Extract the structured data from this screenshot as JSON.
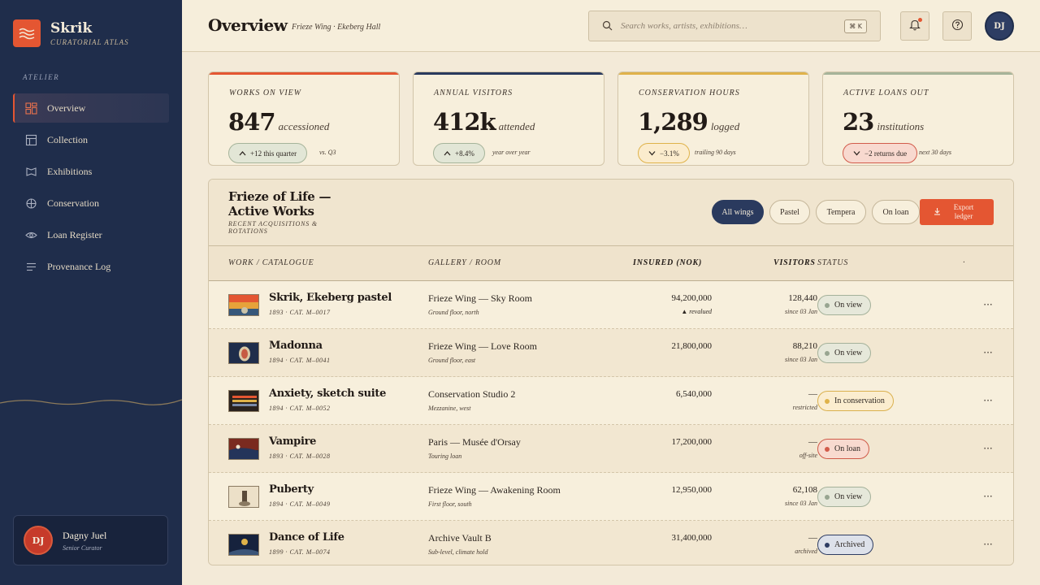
{
  "brand": {
    "name": "Skrik",
    "subtitle": "CURATORIAL ATLAS"
  },
  "sidebar": {
    "section_label": "ATELIER",
    "items": [
      {
        "label": "Overview",
        "icon": "dashboard-icon",
        "active": true
      },
      {
        "label": "Collection",
        "icon": "table-icon",
        "active": false
      },
      {
        "label": "Exhibitions",
        "icon": "flag-icon",
        "active": false
      },
      {
        "label": "Conservation",
        "icon": "crosshair-icon",
        "active": false
      },
      {
        "label": "Loan Register",
        "icon": "eye-icon",
        "active": false
      },
      {
        "label": "Provenance Log",
        "icon": "lines-icon",
        "active": false
      }
    ],
    "user": {
      "initials": "DJ",
      "name": "Dagny Juel",
      "role": "Senior Curator"
    }
  },
  "header": {
    "title": "Overview",
    "subtitle": "Frieze Wing · Ekeberg Hall",
    "search_placeholder": "Search works, artists, exhibitions…",
    "shortcut": "⌘ K",
    "avatar_initials": "DJ"
  },
  "stats": [
    {
      "label": "WORKS ON VIEW",
      "value": "847",
      "unit": "accessioned",
      "pill": "+12 this quarter",
      "note": "vs. Q3",
      "color": "#e45632"
    },
    {
      "label": "ANNUAL VISITORS",
      "value": "412k",
      "unit": "attended",
      "pill": "+8.4%",
      "note": "year over year",
      "color": "#2a3a5e"
    },
    {
      "label": "CONSERVATION HOURS",
      "value": "1,289",
      "unit": "logged",
      "pill": "−3.1%",
      "note": "trailing 90 days",
      "color": "#dfb24a"
    },
    {
      "label": "ACTIVE LOANS OUT",
      "value": "23",
      "unit": "institutions",
      "pill": "−2 returns due",
      "note": "next 30 days",
      "color": "#a6b49a"
    }
  ],
  "panel": {
    "title": "Frieze of Life — Active Works",
    "subtitle": "RECENT ACQUISITIONS & ROTATIONS",
    "filters": [
      "All wings",
      "Pastel",
      "Tempera",
      "On loan"
    ],
    "active_filter": "All wings",
    "export_label": "Export ledger",
    "columns": {
      "work": "WORK / CATALOGUE",
      "gallery": "GALLERY / ROOM",
      "insured": "INSURED (NOK)",
      "visitors": "VISITORS",
      "status": "STATUS",
      "extra": "·"
    },
    "rows": [
      {
        "title": "Skrik, Ekeberg pastel",
        "meta": "1893 · CAT. M–0017",
        "gallery": "Frieze Wing — Sky Room",
        "gallery_sub": "Ground floor, north",
        "insured": "94,200,000",
        "insured_note": "▲ revalued",
        "visitors": "128,440",
        "visitors_note": "since 03 Jan",
        "status": "On view",
        "status_kind": "view"
      },
      {
        "title": "Madonna",
        "meta": "1894 · CAT. M–0041",
        "gallery": "Frieze Wing — Love Room",
        "gallery_sub": "Ground floor, east",
        "insured": "21,800,000",
        "insured_note": "",
        "visitors": "88,210",
        "visitors_note": "since 03 Jan",
        "status": "On view",
        "status_kind": "view"
      },
      {
        "title": "Anxiety, sketch suite",
        "meta": "1894 · CAT. M–0052",
        "gallery": "Conservation Studio 2",
        "gallery_sub": "Mezzanine, west",
        "insured": "6,540,000",
        "insured_note": "",
        "visitors": "—",
        "visitors_note": "restricted",
        "status": "In conservation",
        "status_kind": "cons"
      },
      {
        "title": "Vampire",
        "meta": "1893 · CAT. M–0028",
        "gallery": "Paris — Musée d'Orsay",
        "gallery_sub": "Touring loan",
        "insured": "17,200,000",
        "insured_note": "",
        "visitors": "—",
        "visitors_note": "off-site",
        "status": "On loan",
        "status_kind": "loan"
      },
      {
        "title": "Puberty",
        "meta": "1894 · CAT. M–0049",
        "gallery": "Frieze Wing — Awakening Room",
        "gallery_sub": "First floor, south",
        "insured": "12,950,000",
        "insured_note": "",
        "visitors": "62,108",
        "visitors_note": "since 03 Jan",
        "status": "On view",
        "status_kind": "view"
      },
      {
        "title": "Dance of Life",
        "meta": "1899 · CAT. M–0074",
        "gallery": "Archive Vault B",
        "gallery_sub": "Sub-level, climate hold",
        "insured": "31,400,000",
        "insured_note": "",
        "visitors": "—",
        "visitors_note": "archived",
        "status": "Archived",
        "status_kind": "arch"
      }
    ]
  },
  "colors": {
    "accent": "#e45632",
    "navy": "#1f2d4b",
    "paper": "#f3ead8",
    "amber": "#dfb24a",
    "sage": "#a6b49a"
  }
}
